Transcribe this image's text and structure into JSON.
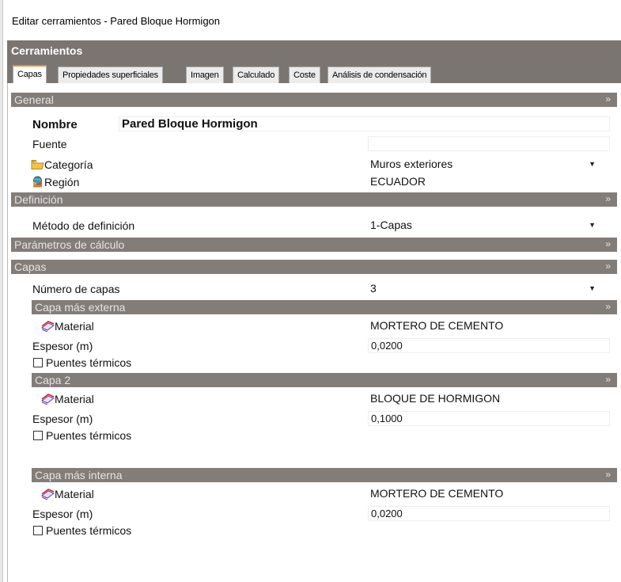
{
  "window": {
    "title": "Editar cerramientos - Pared Bloque Hormigon"
  },
  "header": {
    "title": "Cerramientos"
  },
  "tabs": [
    {
      "label": "Capas",
      "active": true
    },
    {
      "label": "Propiedades superficiales"
    },
    {
      "label": "Imagen"
    },
    {
      "label": "Calculado"
    },
    {
      "label": "Coste"
    },
    {
      "label": "Análisis de condensación"
    }
  ],
  "sections": {
    "general": {
      "title": "General",
      "nombre_label": "Nombre",
      "nombre_value": "Pared Bloque Hormigon",
      "fuente_label": "Fuente",
      "fuente_value": "",
      "categoria_label": "Categoría",
      "categoria_value": "Muros exteriores",
      "region_label": "Región",
      "region_value": "ECUADOR"
    },
    "definicion": {
      "title": "Definición",
      "metodo_label": "Método de definición",
      "metodo_value": "1-Capas"
    },
    "parametros": {
      "title": "Parámetros de cálculo"
    },
    "capas": {
      "title": "Capas",
      "numero_label": "Número de capas",
      "numero_value": "3",
      "layers": [
        {
          "title": "Capa más externa",
          "material_label": "Material",
          "material_value": "MORTERO DE CEMENTO",
          "espesor_label": "Espesor (m)",
          "espesor_value": "0,0200",
          "puentes_label": "Puentes térmicos"
        },
        {
          "title": "Capa 2",
          "material_label": "Material",
          "material_value": "BLOQUE DE HORMIGON",
          "espesor_label": "Espesor (m)",
          "espesor_value": "0,1000",
          "puentes_label": "Puentes térmicos"
        },
        {
          "title": "Capa más interna",
          "material_label": "Material",
          "material_value": "MORTERO DE CEMENTO",
          "espesor_label": "Espesor (m)",
          "espesor_value": "0,0200",
          "puentes_label": "Puentes térmicos"
        }
      ]
    }
  },
  "icons": {
    "collapse": "double-chevron-down-icon",
    "expand": "double-chevron-right-icon",
    "dropdown": "triangle-down-icon",
    "folder": "folder-icon",
    "region": "globe-people-icon",
    "material": "material-layers-icon"
  },
  "colors": {
    "band": "#837d7a",
    "header": "#7b7572",
    "active_tab_accent": "#f28a2b",
    "folder": "#f5c342"
  }
}
